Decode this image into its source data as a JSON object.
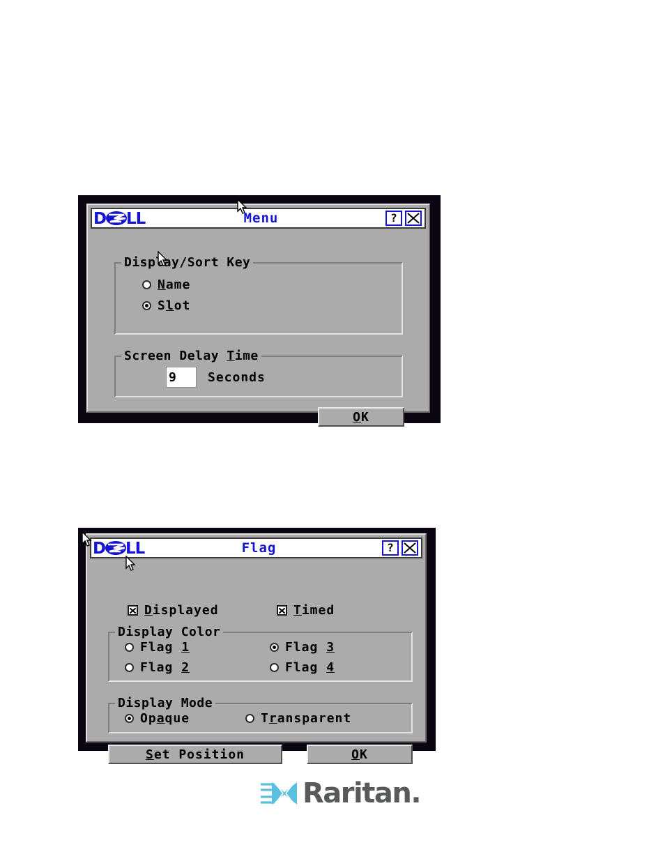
{
  "page": {
    "background_color": "#ffffff",
    "footer_logo": {
      "brand": "Raritan",
      "wordmark": "Raritan.",
      "mark_color": "#5bc0de",
      "text_color": "#58595b"
    }
  },
  "dialogs": [
    {
      "id": "menu-dialog",
      "titlebar": {
        "logo": "DELL",
        "title": "Menu",
        "help_button": "?",
        "close_button": "X",
        "logo_color": "#1414d2",
        "title_color": "#1414d2"
      },
      "groups": [
        {
          "id": "display-sort-key",
          "title": "Display/Sort Key",
          "options": [
            {
              "label_prefix": "",
              "label_accel": "N",
              "label_suffix": "ame",
              "text": "Name",
              "selected": false
            },
            {
              "label_prefix": "S",
              "label_accel": "l",
              "label_suffix": "ot",
              "text": "Slot",
              "selected": true
            }
          ]
        },
        {
          "id": "screen-delay-time",
          "title_prefix": "Screen Delay ",
          "title_accel": "T",
          "title_suffix": "ime",
          "title": "Screen Delay Time",
          "input_value": "9",
          "unit_label": "Seconds"
        }
      ],
      "buttons": [
        {
          "id": "ok",
          "prefix": "",
          "accel": "O",
          "suffix": "K",
          "text": "OK"
        }
      ]
    },
    {
      "id": "flag-dialog",
      "titlebar": {
        "logo": "DELL",
        "title": "Flag",
        "help_button": "?",
        "close_button": "X",
        "logo_color": "#1414d2",
        "title_color": "#1414d2"
      },
      "checkboxes": [
        {
          "id": "displayed",
          "prefix": "",
          "accel": "D",
          "suffix": "isplayed",
          "text": "Displayed",
          "checked": true
        },
        {
          "id": "timed",
          "prefix": "",
          "accel": "T",
          "suffix": "imed",
          "text": "Timed",
          "checked": true
        }
      ],
      "groups": [
        {
          "id": "display-color",
          "title": "Display Color",
          "options": [
            {
              "prefix": "Flag ",
              "accel": "1",
              "suffix": "",
              "text": "Flag 1",
              "selected": false
            },
            {
              "prefix": "Flag ",
              "accel": "2",
              "suffix": "",
              "text": "Flag 2",
              "selected": false
            },
            {
              "prefix": "Flag ",
              "accel": "3",
              "suffix": "",
              "text": "Flag 3",
              "selected": true
            },
            {
              "prefix": "Flag ",
              "accel": "4",
              "suffix": "",
              "text": "Flag 4",
              "selected": false
            }
          ]
        },
        {
          "id": "display-mode",
          "title": "Display Mode",
          "options": [
            {
              "prefix": "Op",
              "accel": "a",
              "suffix": "que",
              "text": "Opaque",
              "selected": true
            },
            {
              "prefix": "T",
              "accel": "r",
              "suffix": "ansparent",
              "text": "Transparent",
              "selected": false
            }
          ]
        }
      ],
      "buttons": [
        {
          "id": "set-position",
          "prefix": "",
          "accel": "S",
          "suffix": "et Position",
          "text": "Set Position"
        },
        {
          "id": "ok",
          "prefix": "",
          "accel": "O",
          "suffix": "K",
          "text": "OK"
        }
      ]
    }
  ]
}
